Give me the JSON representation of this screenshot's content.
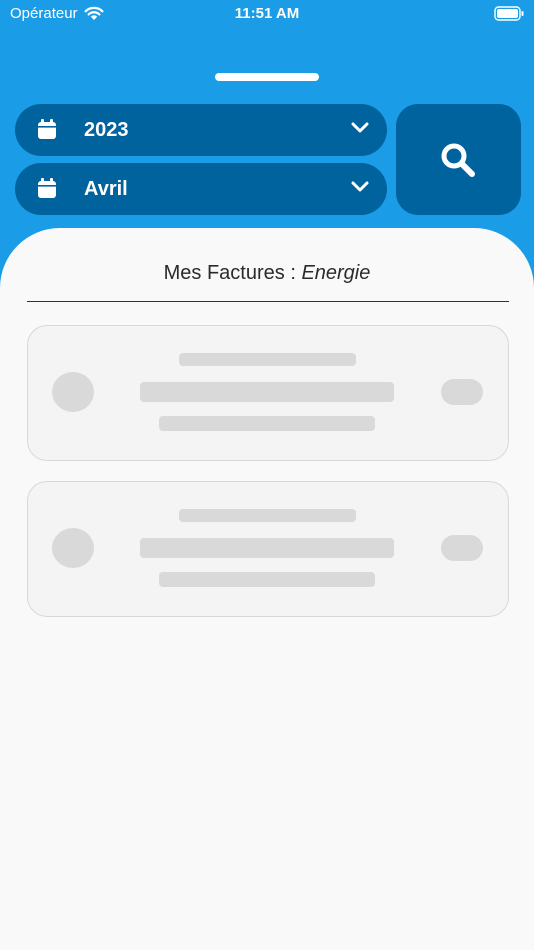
{
  "status_bar": {
    "carrier": "Opérateur",
    "time": "11:51 AM"
  },
  "filters": {
    "year": "2023",
    "month": "Avril"
  },
  "sheet": {
    "title": "Mes Factures : ",
    "subtitle": "Energie"
  },
  "colors": {
    "header_blue": "#1a9de6",
    "picker_blue": "#00639e",
    "sheet_bg": "#f9f9f9",
    "skeleton": "#d9d9d9"
  }
}
